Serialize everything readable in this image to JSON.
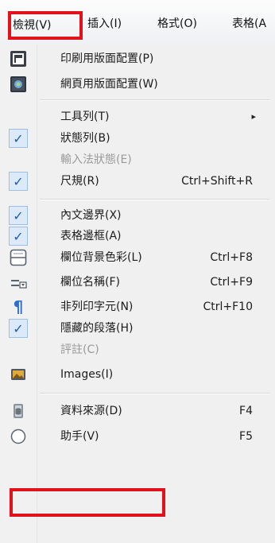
{
  "menubar": {
    "items": [
      {
        "label": "檢視(V)"
      },
      {
        "label": "插入(I)"
      },
      {
        "label": "格式(O)"
      },
      {
        "label": "表格(A"
      }
    ]
  },
  "menu": {
    "items": [
      {
        "label": "印刷用版面配置(P)",
        "icon": "print-layout-icon"
      },
      {
        "label": "網頁用版面配置(W)",
        "icon": "web-layout-icon"
      },
      {
        "label": "工具列(T)",
        "submenu": "▸"
      },
      {
        "label": "狀態列(B)",
        "checked": true,
        "check_glyph": "✓"
      },
      {
        "label": "輸入法狀態(E)",
        "disabled": true
      },
      {
        "label": "尺規(R)",
        "checked": true,
        "check_glyph": "✓",
        "shortcut": "Ctrl+Shift+R"
      },
      {
        "label": "內文邊界(X)",
        "checked": true,
        "check_glyph": "✓"
      },
      {
        "label": "表格邊框(A)",
        "checked": true,
        "check_glyph": "✓"
      },
      {
        "label": "欄位背景色彩(L)",
        "icon": "field-shading-icon",
        "shortcut": "Ctrl+F8"
      },
      {
        "label": "欄位名稱(F)",
        "icon": "field-names-icon",
        "shortcut": "Ctrl+F9"
      },
      {
        "label": "非列印字元(N)",
        "icon": "pilcrow-icon",
        "glyph": "¶",
        "shortcut": "Ctrl+F10"
      },
      {
        "label": "隱藏的段落(H)",
        "checked": true,
        "check_glyph": "✓"
      },
      {
        "label": "評註(C)",
        "disabled": true
      },
      {
        "label": "Images(I)",
        "icon": "images-icon"
      },
      {
        "label": "資料來源(D)",
        "icon": "data-sources-icon",
        "shortcut": "F4"
      },
      {
        "label": "助手(V)",
        "icon": "navigator-icon",
        "shortcut": "F5"
      }
    ]
  },
  "colors": {
    "highlight_box": "#e2121b",
    "check": "#1c5fb5",
    "pilcrow": "#2a6fc9"
  }
}
